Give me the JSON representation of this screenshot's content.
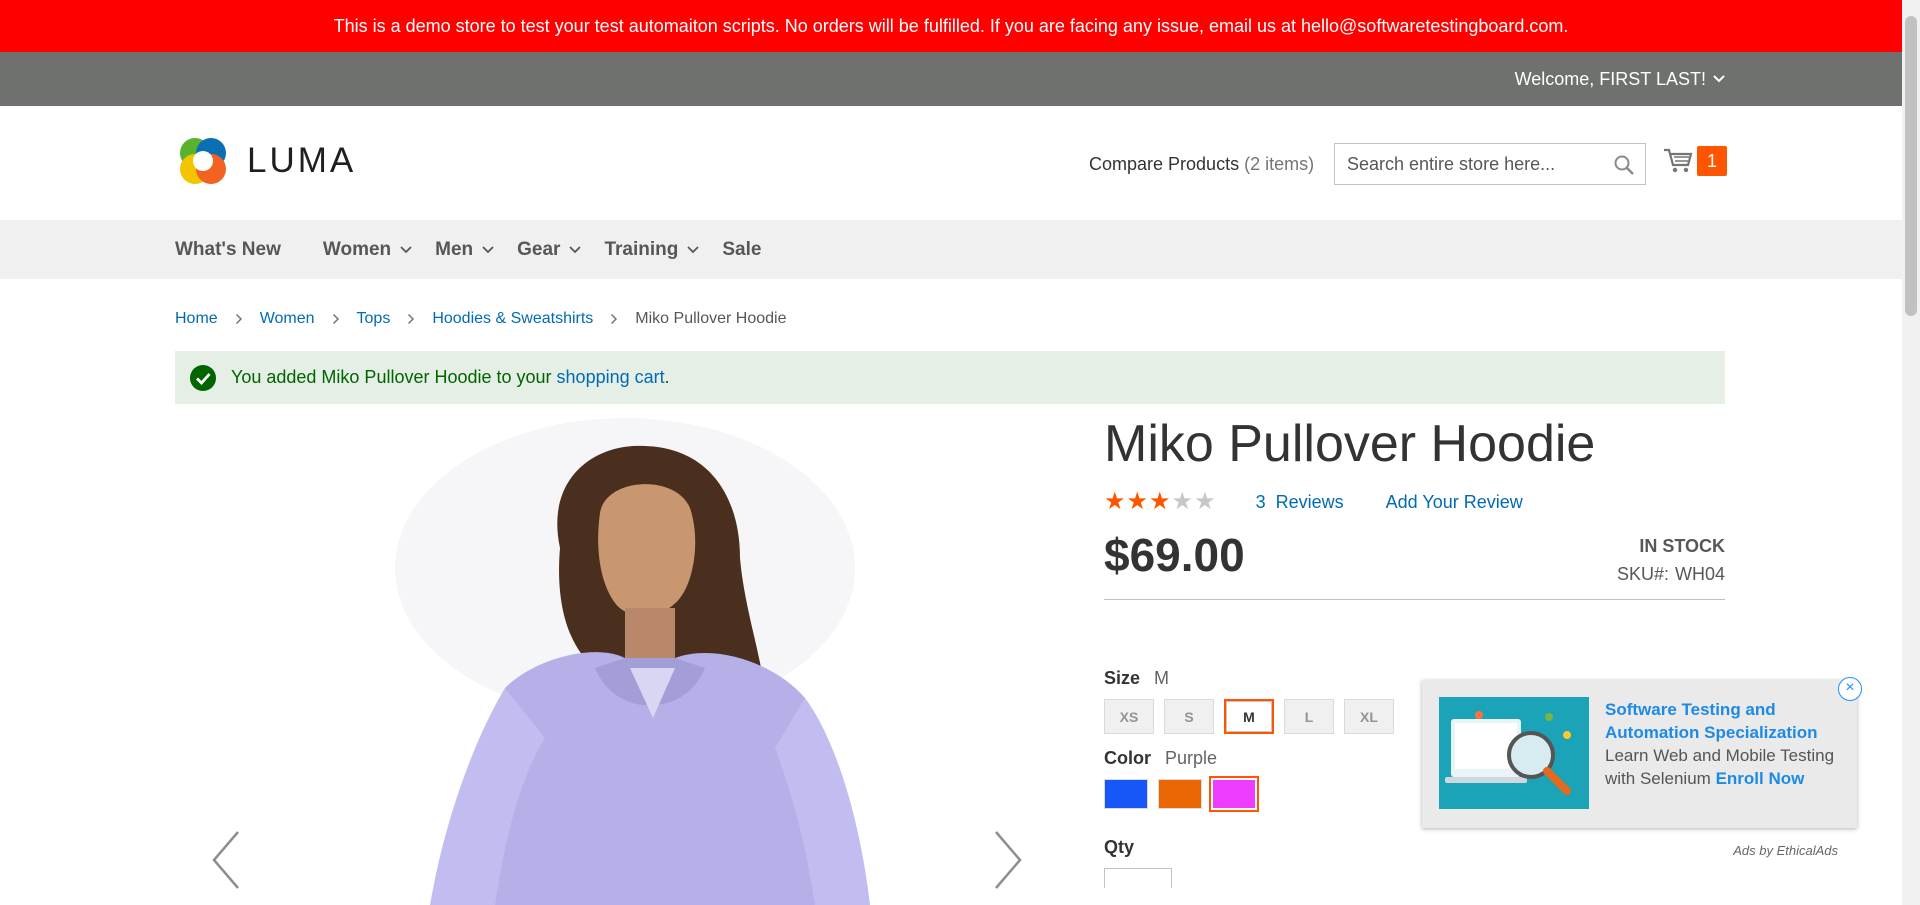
{
  "demo_notice": "This is a demo store to test your test automaiton scripts. No orders will be fulfilled. If you are facing any issue, email us at hello@softwaretestingboard.com.",
  "top_bar": {
    "welcome": "Welcome, FIRST LAST!"
  },
  "header": {
    "logo_text": "LUMA",
    "compare_label": "Compare Products",
    "compare_count": "(2 items)",
    "search_placeholder": "Search entire store here...",
    "cart_count": "1"
  },
  "nav": {
    "items": [
      {
        "label": "What's New",
        "has_dropdown": false
      },
      {
        "label": "Women",
        "has_dropdown": true
      },
      {
        "label": "Men",
        "has_dropdown": true
      },
      {
        "label": "Gear",
        "has_dropdown": true
      },
      {
        "label": "Training",
        "has_dropdown": true
      },
      {
        "label": "Sale",
        "has_dropdown": false
      }
    ]
  },
  "breadcrumbs": {
    "links": [
      "Home",
      "Women",
      "Tops",
      "Hoodies & Sweatshirts"
    ],
    "current": "Miko Pullover Hoodie"
  },
  "message": {
    "prefix": "You added Miko Pullover Hoodie to your ",
    "link": "shopping cart",
    "suffix": "."
  },
  "product": {
    "title": "Miko Pullover Hoodie",
    "rating_stars": 3,
    "rating_max": 5,
    "reviews_count": "3",
    "reviews_label": "Reviews",
    "add_review": "Add Your Review",
    "price": "$69.00",
    "stock": "In stock",
    "sku_label": "SKU#:",
    "sku": "WH04",
    "size_label": "Size",
    "size_selected": "M",
    "sizes": [
      "XS",
      "S",
      "M",
      "L",
      "XL"
    ],
    "color_label": "Color",
    "color_selected": "Purple",
    "colors": [
      {
        "name": "Blue",
        "hex": "#1857f7"
      },
      {
        "name": "Orange",
        "hex": "#eb6703"
      },
      {
        "name": "Purple",
        "hex": "#ef3dff"
      }
    ],
    "qty_label": "Qty"
  },
  "ad": {
    "title": "Software Testing and Automation Specialization",
    "body": "Learn Web and Mobile Testing with Selenium",
    "cta": "Enroll Now",
    "by": "Ads by EthicalAds",
    "close": "×"
  },
  "colors": {
    "demo_bar": "#ff0000",
    "top_bar": "#6e716e",
    "accent": "#ff5501",
    "link": "#006bb4",
    "success_bg": "#e5efe5"
  }
}
